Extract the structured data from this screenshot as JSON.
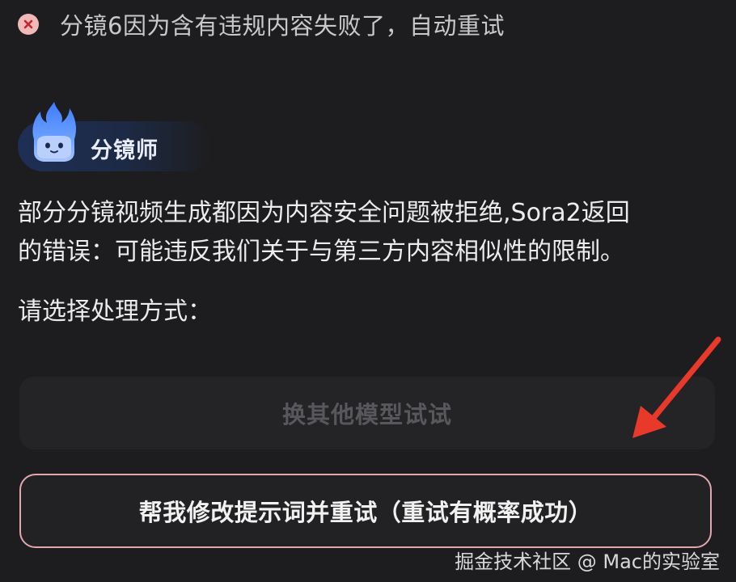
{
  "status": {
    "icon": "error-icon",
    "text": "分镜6因为含有违规内容失败了，自动重试"
  },
  "agent": {
    "avatar_icon": "flame-mascot-icon",
    "name": "分镜师"
  },
  "message": {
    "line1": "部分分镜视频生成都因为内容安全问题被拒绝,Sora2返回",
    "line2": "的错误：可能违反我们关于与第三方内容相似性的限制。",
    "prompt": "请选择处理方式："
  },
  "options": {
    "other_model_label": "换其他模型试试",
    "modify_prompt_label": "帮我修改提示词并重试（重试有概率成功）"
  },
  "annotation": {
    "arrow_icon": "red-arrow-icon",
    "color": "#e8392b"
  },
  "watermark": {
    "text": "掘金技术社区 @ Mac的实验室"
  },
  "colors": {
    "background": "#1d1d1f",
    "primary_border": "#e2a6ae",
    "agent_chip": "#1e2f55"
  }
}
